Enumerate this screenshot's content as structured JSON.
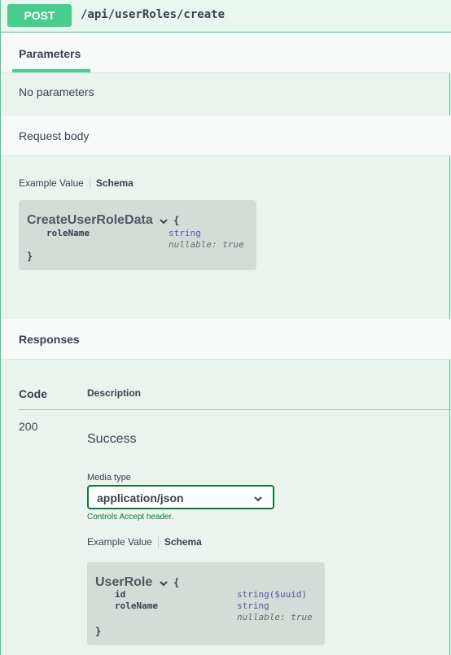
{
  "endpoint": {
    "method": "POST",
    "path": "/api/userRoles/create"
  },
  "parameters": {
    "tab_label": "Parameters",
    "empty_text": "No parameters"
  },
  "request_body": {
    "label": "Request body",
    "example_tab": "Example Value",
    "schema_tab": "Schema",
    "model": {
      "name": "CreateUserRoleData",
      "open_brace": "{",
      "close_brace": "}",
      "props": [
        {
          "name": "roleName",
          "type": "string",
          "nullable": "nullable: true"
        }
      ]
    }
  },
  "responses": {
    "title": "Responses",
    "code_header": "Code",
    "description_header": "Description",
    "rows": [
      {
        "code": "200",
        "description": "Success",
        "media_type_label": "Media type",
        "media_type_value": "application/json",
        "media_type_hint": "Controls Accept header.",
        "example_tab": "Example Value",
        "schema_tab": "Schema",
        "model": {
          "name": "UserRole",
          "open_brace": "{",
          "close_brace": "}",
          "props": [
            {
              "name": "id",
              "type": "string($uuid)"
            },
            {
              "name": "roleName",
              "type": "string",
              "nullable": "nullable: true"
            }
          ]
        }
      }
    ]
  },
  "colors": {
    "accent": "#49cc90",
    "background": "#ebf3ee",
    "text": "#3b4151"
  }
}
